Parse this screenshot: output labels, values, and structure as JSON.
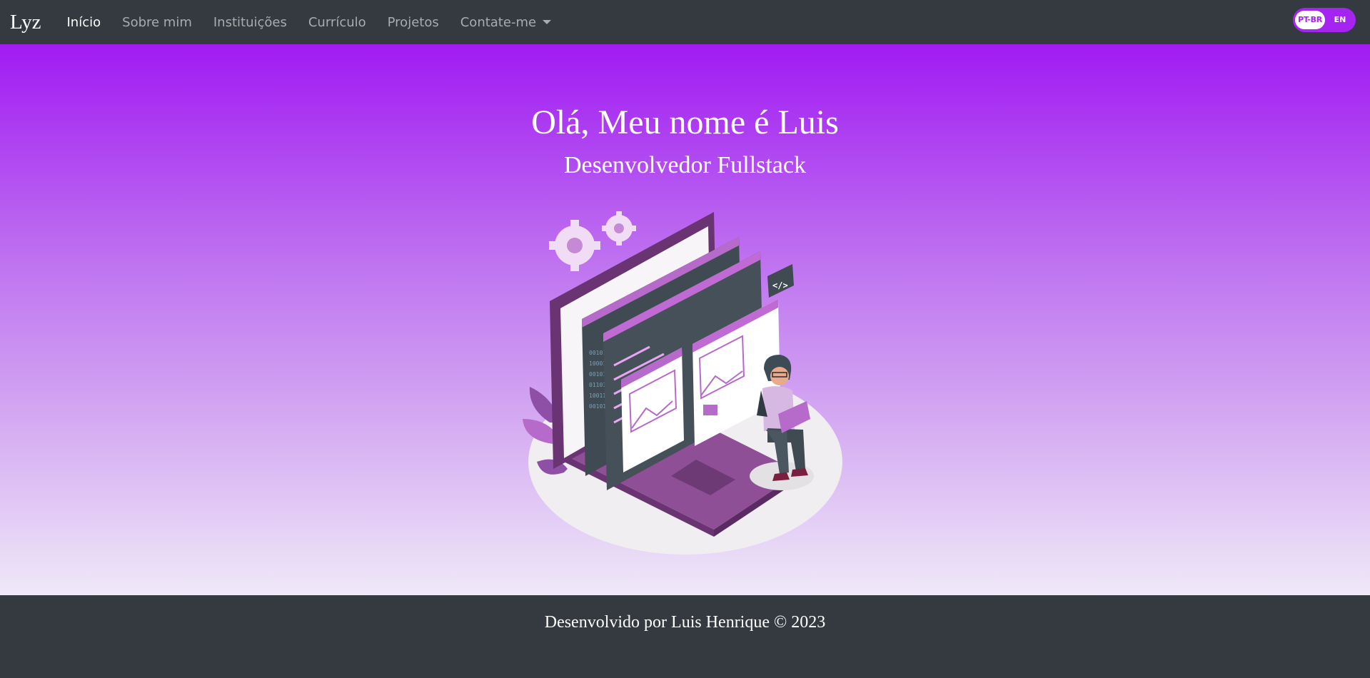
{
  "navbar": {
    "brand": "Lyz",
    "items": [
      {
        "label": "Início",
        "active": true
      },
      {
        "label": "Sobre mim"
      },
      {
        "label": "Instituições"
      },
      {
        "label": "Currículo"
      },
      {
        "label": "Projetos"
      },
      {
        "label": "Contate-me",
        "dropdown": true
      }
    ],
    "language": {
      "selected": "PT-BR",
      "options": [
        "PT-BR",
        "EN"
      ]
    }
  },
  "hero": {
    "title": "Olá, Meu nome é Luis",
    "subtitle": "Desenvolvedor Fullstack",
    "illustration": "developer-with-laptop-and-code-windows"
  },
  "footer": {
    "text": "Desenvolvido por Luis Henrique © 2023"
  },
  "colors": {
    "navbar_bg": "#343a40",
    "accent": "#a524ef",
    "hero_top": "#a11bf2",
    "hero_bottom": "#efe9f8"
  }
}
